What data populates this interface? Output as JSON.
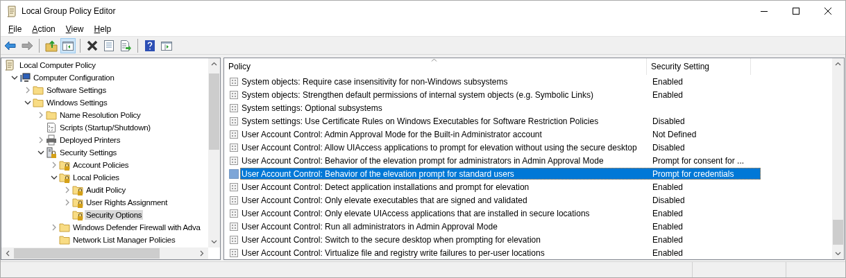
{
  "window": {
    "title": "Local Group Policy Editor"
  },
  "menu": [
    {
      "label": "File"
    },
    {
      "label": "Action"
    },
    {
      "label": "View"
    },
    {
      "label": "Help"
    }
  ],
  "toolbar": [
    {
      "kind": "back",
      "pressed": false,
      "disabled": false
    },
    {
      "kind": "forward",
      "pressed": false,
      "disabled": true
    },
    {
      "kind": "up",
      "pressed": false,
      "disabled": false
    },
    {
      "kind": "tree",
      "pressed": true,
      "disabled": false
    },
    {
      "kind": "delete",
      "pressed": false,
      "disabled": false
    },
    {
      "kind": "properties",
      "pressed": false,
      "disabled": false
    },
    {
      "kind": "export",
      "pressed": false,
      "disabled": false
    },
    {
      "kind": "help",
      "pressed": false,
      "disabled": false
    },
    {
      "kind": "action-pane",
      "pressed": false,
      "disabled": false
    }
  ],
  "tree": [
    {
      "label": "Local Computer Policy",
      "kind": "scroll",
      "selected": false,
      "children": [
        {
          "label": "Computer Configuration",
          "kind": "computer",
          "expanded": true,
          "selected": false,
          "children": [
            {
              "label": "Software Settings",
              "kind": "folder",
              "expanded": false,
              "selected": false
            },
            {
              "label": "Windows Settings",
              "kind": "folder",
              "expanded": true,
              "selected": false,
              "children": [
                {
                  "label": "Name Resolution Policy",
                  "kind": "folder",
                  "expanded": false,
                  "selected": false
                },
                {
                  "label": "Scripts (Startup/Shutdown)",
                  "kind": "script",
                  "selected": false
                },
                {
                  "label": "Deployed Printers",
                  "kind": "printer",
                  "expanded": false,
                  "selected": false
                },
                {
                  "label": "Security Settings",
                  "kind": "security",
                  "expanded": true,
                  "selected": false,
                  "children": [
                    {
                      "label": "Account Policies",
                      "kind": "locked-folder",
                      "expanded": false,
                      "selected": false
                    },
                    {
                      "label": "Local Policies",
                      "kind": "locked-folder",
                      "expanded": true,
                      "selected": false,
                      "children": [
                        {
                          "label": "Audit Policy",
                          "kind": "locked-folder",
                          "expanded": false,
                          "selected": false
                        },
                        {
                          "label": "User Rights Assignment",
                          "kind": "locked-folder",
                          "expanded": false,
                          "selected": false
                        },
                        {
                          "label": "Security Options",
                          "kind": "locked-folder",
                          "selected": true
                        }
                      ]
                    },
                    {
                      "label": "Windows Defender Firewall with Adva",
                      "kind": "folder",
                      "expanded": false,
                      "selected": false
                    },
                    {
                      "label": "Network List Manager Policies",
                      "kind": "folder",
                      "selected": false
                    }
                  ]
                }
              ]
            }
          ]
        }
      ]
    }
  ],
  "table": {
    "columns": [
      "Policy",
      "Security Setting"
    ],
    "rows": [
      {
        "policy": "System objects: Require case insensitivity for non-Windows subsystems",
        "setting": "Enabled",
        "selected": false
      },
      {
        "policy": "System objects: Strengthen default permissions of internal system objects (e.g. Symbolic Links)",
        "setting": "Enabled",
        "selected": false
      },
      {
        "policy": "System settings: Optional subsystems",
        "selected": false
      },
      {
        "policy": "System settings: Use Certificate Rules on Windows Executables for Software Restriction Policies",
        "setting": "Disabled",
        "selected": false
      },
      {
        "policy": "User Account Control: Admin Approval Mode for the Built-in Administrator account",
        "setting": "Not Defined",
        "selected": false
      },
      {
        "policy": "User Account Control: Allow UIAccess applications to prompt for elevation without using the secure desktop",
        "setting": "Disabled",
        "selected": false
      },
      {
        "policy": "User Account Control: Behavior of the elevation prompt for administrators in Admin Approval Mode",
        "setting": "Prompt for consent for ...",
        "selected": false
      },
      {
        "policy": "User Account Control: Behavior of the elevation prompt for standard users",
        "setting": "Prompt for credentials",
        "selected": true
      },
      {
        "policy": "User Account Control: Detect application installations and prompt for elevation",
        "setting": "Enabled",
        "selected": false
      },
      {
        "policy": "User Account Control: Only elevate executables that are signed and validated",
        "setting": "Disabled",
        "selected": false
      },
      {
        "policy": "User Account Control: Only elevate UIAccess applications that are installed in secure locations",
        "setting": "Enabled",
        "selected": false
      },
      {
        "policy": "User Account Control: Run all administrators in Admin Approval Mode",
        "setting": "Enabled",
        "selected": false
      },
      {
        "policy": "User Account Control: Switch to the secure desktop when prompting for elevation",
        "setting": "Enabled",
        "selected": false
      },
      {
        "policy": "User Account Control: Virtualize file and registry write failures to per-user locations",
        "setting": "Enabled",
        "selected": false
      }
    ]
  }
}
